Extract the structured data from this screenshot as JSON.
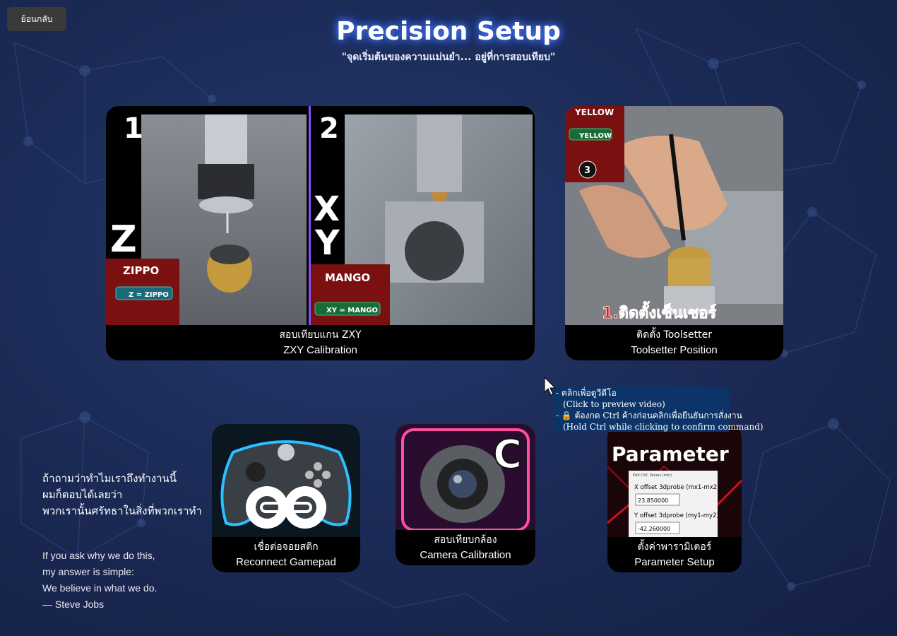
{
  "header": {
    "back_label": "ย้อนกลับ",
    "title": "Precision Setup",
    "subtitle": "\"จุดเริ่มต้นของความแม่นยำ... อยู่ที่การสอบเทียบ\""
  },
  "cards": {
    "zxy": {
      "caption_th": "สอบเทียบแกน ZXY",
      "caption_en": "ZXY Calibration",
      "thumb_text": {
        "num1": "1",
        "num2": "2",
        "axis_z": "Z",
        "axis_x": "X",
        "axis_y": "Y",
        "label_zippo": "ZIPPO",
        "badge_zippo": "Z = ZIPPO",
        "label_mango": "MANGO",
        "badge_mango": "XY = MANGO"
      }
    },
    "toolsetter": {
      "caption_th": "ติดตั้ง Toolsetter",
      "caption_en": "Toolsetter Position",
      "thumb_text": {
        "label_yellow": "YELLOW",
        "badge_yellow": "YELLOW",
        "num3": "3",
        "overlay": "1.ติดตั้งเซ็นเซอร์"
      }
    },
    "gamepad": {
      "caption_th": "เชื่อต่อจอยสติก",
      "caption_en": "Reconnect Gamepad"
    },
    "camera": {
      "caption_th": "สอบเทียบกล้อง",
      "caption_en": "Camera Calibration",
      "thumb_letter": "C"
    },
    "parameter": {
      "caption_th": "ตั้งค่าพารามิเตอร์",
      "caption_en": "Parameter Setup",
      "thumb_text": {
        "heading": "Parameter",
        "window_title": "Edit CNC Values (mm)",
        "x_label": "X offset 3dprobe (mx1-mx2)",
        "x_value": "23.850000",
        "y_label": "Y offset 3dprobe (my1-my2)",
        "y_value": "-42.260000"
      }
    }
  },
  "tooltip": {
    "line1": "- คลิกเพื่อดูวีดีโอ",
    "line2": "(Click to preview video)",
    "line3": "- 🔒 ต้องกด Ctrl ค้างก่อนคลิกเพื่อยืนยันการสั่งงาน",
    "line4": "(Hold Ctrl while clicking to confirm command)"
  },
  "quote_th": {
    "line1": "ถ้าถามว่าทำไมเราถึงทำงานนี้",
    "line2": "ผมก็ตอบได้เลยว่า",
    "line3": "พวกเรานั้นศรัทธาในสิ่งที่พวกเราทำ"
  },
  "quote_en": {
    "line1": "If you ask why we do this,",
    "line2": "my answer is simple:",
    "line3": "We believe in what we do.",
    "line4": "— Steve Jobs"
  },
  "colors": {
    "background": "#1c2c58",
    "title_glow": "#3366ff",
    "tooltip_bg": "#0d3468",
    "card_border_red": "#e03a3a",
    "card_border_purple": "#8a4dff",
    "card_border_orange": "#f08a3a"
  }
}
